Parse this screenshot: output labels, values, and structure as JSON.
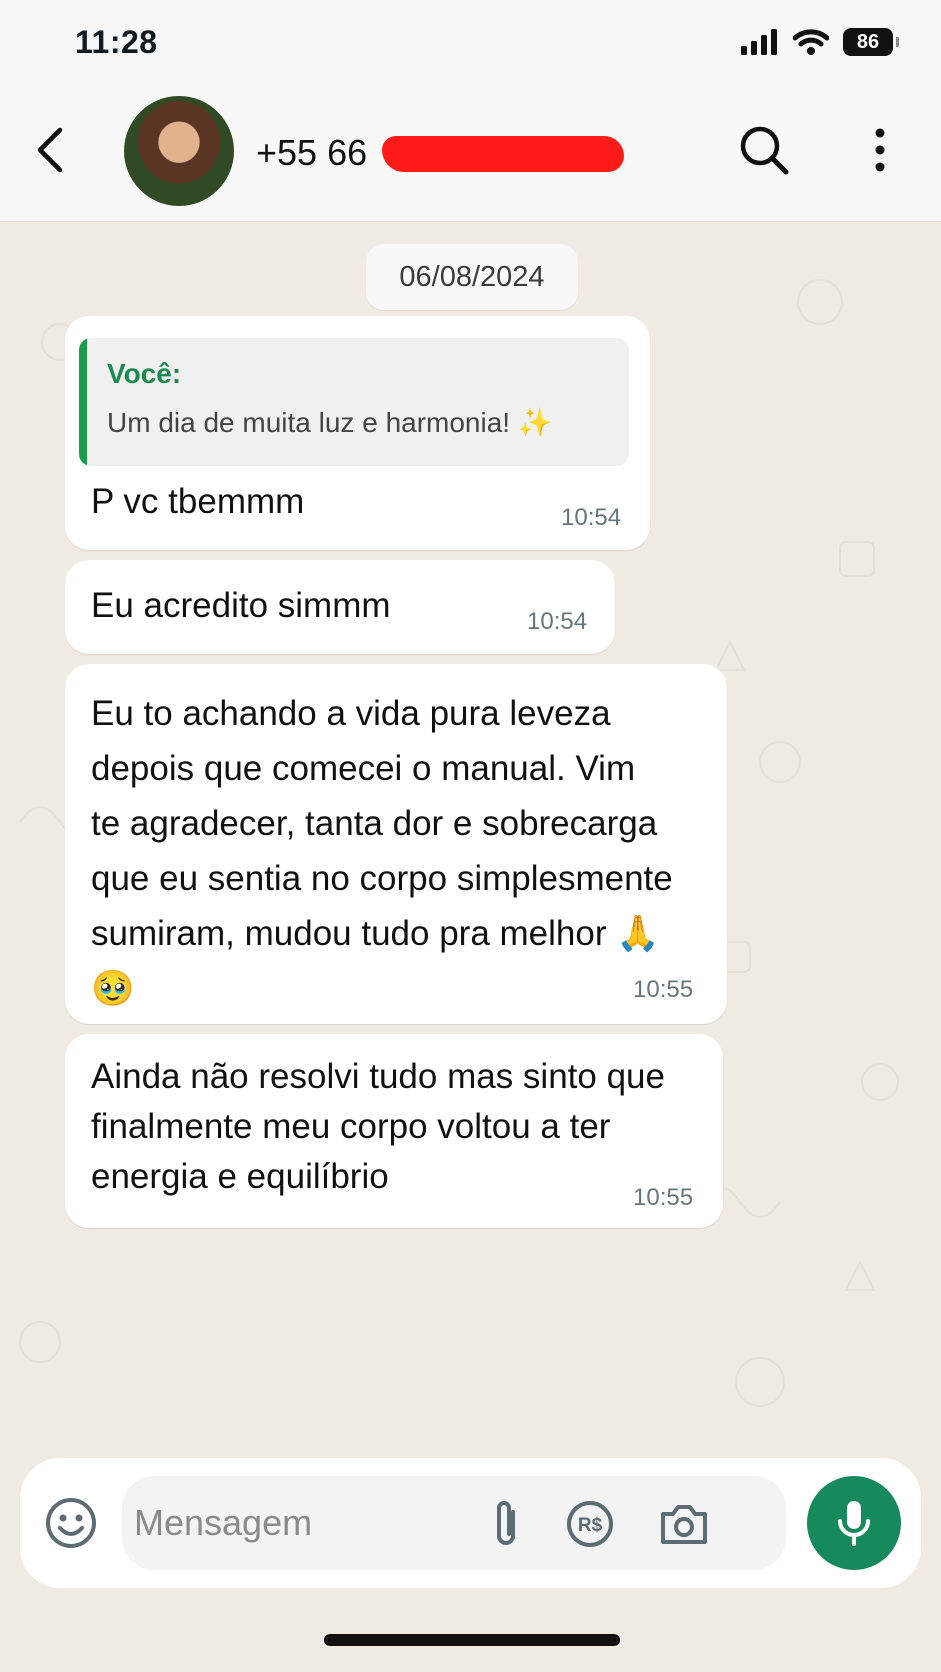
{
  "status_bar": {
    "time": "11:28",
    "battery": "86"
  },
  "header": {
    "contact_name": "+55 66"
  },
  "chat": {
    "date_chip": "06/08/2024",
    "messages": [
      {
        "quote_author": "Você:",
        "quote_text": "Um dia de muita luz e harmonia! ✨",
        "lines": [
          "P vc tbemmm"
        ],
        "time": "10:54"
      },
      {
        "lines": [
          "Eu acredito simmm"
        ],
        "time": "10:54"
      },
      {
        "lines": [
          "Eu to achando a vida pura leveza",
          "depois que comecei o manual. Vim",
          "te agradecer, tanta dor e sobrecarga",
          "que eu sentia no corpo simplesmente",
          "sumiram, mudou tudo pra melhor 🙏",
          "🥹"
        ],
        "time": "10:55"
      },
      {
        "lines": [
          "Ainda não resolvi tudo mas sinto que",
          "finalmente meu corpo voltou a ter",
          "energia e equilíbrio"
        ],
        "time": "10:55"
      }
    ]
  },
  "composer": {
    "placeholder": "Mensagem"
  }
}
